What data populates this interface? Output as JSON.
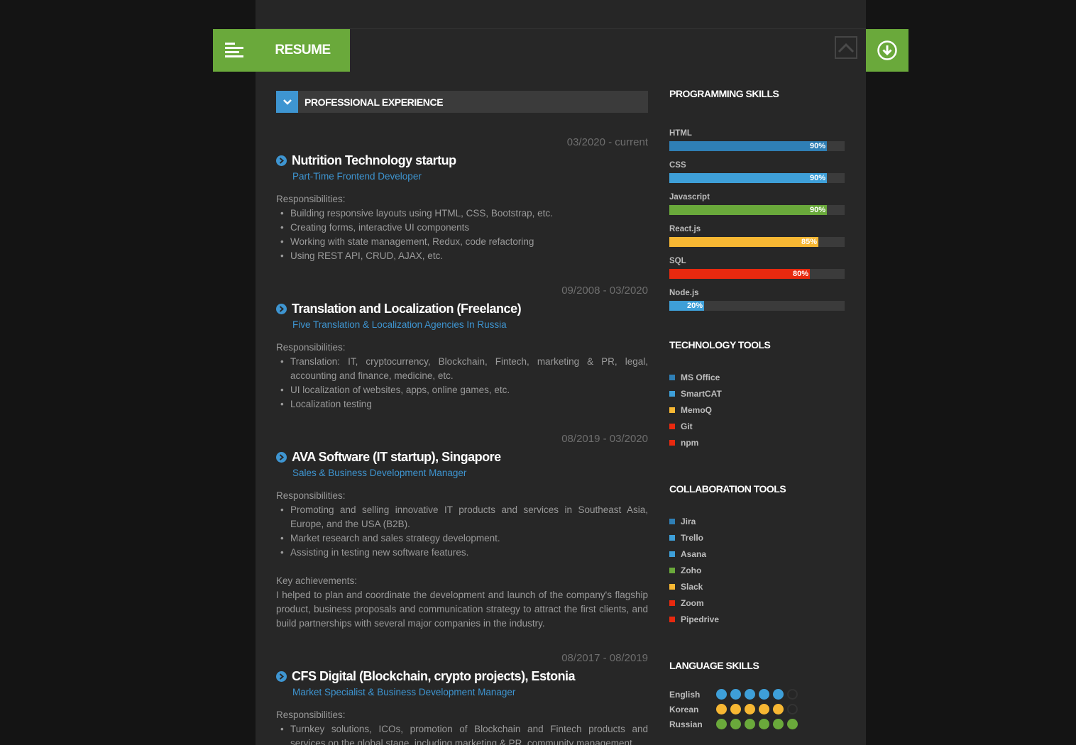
{
  "header": {
    "title": "RESUME"
  },
  "experience": {
    "section_title": "PROFESSIONAL EXPERIENCE",
    "jobs": [
      {
        "dates": "03/2020 - current",
        "company": "Nutrition Technology startup",
        "role": "Part-Time Frontend Developer",
        "responsibilities_label": "Responsibilities:",
        "items": [
          "Building responsive layouts using HTML, CSS, Bootstrap, etc.",
          "Creating forms, interactive UI components",
          "Working with state management, Redux, code refactoring",
          "Using REST API, CRUD, AJAX, etc."
        ]
      },
      {
        "dates": "09/2008 - 03/2020",
        "company": "Translation and Localization (Freelance)",
        "role": "Five Translation & Localization Agencies In Russia",
        "responsibilities_label": "Responsibilities:",
        "items": [
          "Translation: IT, cryptocurrency, Blockchain, Fintech, marketing & PR, legal, accounting and finance, medicine, etc.",
          "UI localization of websites, apps, online games, etc.",
          "Localization testing"
        ]
      },
      {
        "dates": "08/2019 - 03/2020",
        "company": "AVA Software (IT startup), Singapore",
        "role": "Sales & Business Development Manager",
        "responsibilities_label": "Responsibilities:",
        "items": [
          "Promoting and selling innovative IT products and services in Southeast Asia, Europe, and the USA (B2B).",
          "Market research and sales strategy development.",
          "Assisting in testing new software features."
        ],
        "achievements_label": "Key achievements:",
        "achievements": "I helped to plan and coordinate the development and launch of the company's flagship product, business proposals and communication strategy to attract the first clients, and build partnerships with several major companies in the industry."
      },
      {
        "dates": "08/2017 - 08/2019",
        "company": "CFS Digital (Blockchain, crypto projects), Estonia",
        "role": "Market Specialist & Business Development Manager",
        "responsibilities_label": "Responsibilities:",
        "items": [
          "Turnkey solutions, ICOs, promotion of Blockchain and Fintech products and services on the global stage, including marketing & PR, community management"
        ]
      }
    ]
  },
  "programming": {
    "title": "PROGRAMMING SKILLS",
    "skills": [
      {
        "name": "HTML",
        "percent": 90,
        "label": "90%",
        "color": "#2f7fb5"
      },
      {
        "name": "CSS",
        "percent": 90,
        "label": "90%",
        "color": "#3e9fd8"
      },
      {
        "name": "Javascript",
        "percent": 90,
        "label": "90%",
        "color": "#6aa93b"
      },
      {
        "name": "React.js",
        "percent": 85,
        "label": "85%",
        "color": "#f7b733"
      },
      {
        "name": "SQL",
        "percent": 80,
        "label": "80%",
        "color": "#e8290f"
      },
      {
        "name": "Node.js",
        "percent": 20,
        "label": "20%",
        "color": "#3e9fd8"
      }
    ]
  },
  "technology": {
    "title": "TECHNOLOGY TOOLS",
    "items": [
      {
        "name": "MS Office",
        "color": "#2f7fb5"
      },
      {
        "name": "SmartCAT",
        "color": "#3e9fd8"
      },
      {
        "name": "MemoQ",
        "color": "#f7b733"
      },
      {
        "name": "Git",
        "color": "#e8290f"
      },
      {
        "name": "npm",
        "color": "#e8290f"
      }
    ]
  },
  "collaboration": {
    "title": "COLLABORATION TOOLS",
    "items": [
      {
        "name": "Jira",
        "color": "#2f7fb5"
      },
      {
        "name": "Trello",
        "color": "#3e9fd8"
      },
      {
        "name": "Asana",
        "color": "#3e9fd8"
      },
      {
        "name": "Zoho",
        "color": "#6aa93b"
      },
      {
        "name": "Slack",
        "color": "#f7b733"
      },
      {
        "name": "Zoom",
        "color": "#e8290f"
      },
      {
        "name": "Pipedrive",
        "color": "#e8290f"
      }
    ]
  },
  "languages": {
    "title": "LANGUAGE SKILLS",
    "items": [
      {
        "name": "English",
        "level": 5,
        "max": 6,
        "color": "#3e9fd8"
      },
      {
        "name": "Korean",
        "level": 5,
        "max": 6,
        "color": "#f7b733"
      },
      {
        "name": "Russian",
        "level": 6,
        "max": 6,
        "color": "#6aa93b"
      }
    ]
  },
  "icons": {
    "menu": "menu-lines-icon",
    "download": "download-circle-icon",
    "scroll_top": "chevron-up-icon",
    "collapse": "chevron-down-icon",
    "job_bullet": "chevron-right-circle-icon"
  }
}
